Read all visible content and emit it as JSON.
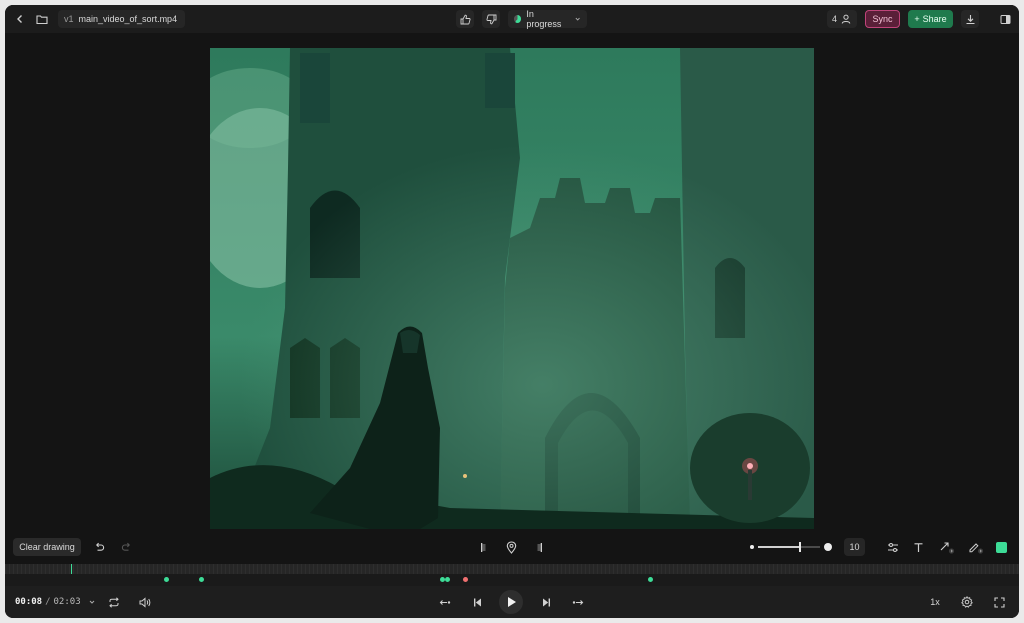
{
  "header": {
    "back_icon": "chevron-left-icon",
    "folder_icon": "folder-icon",
    "version": "v1",
    "filename": "main_video_of_sort.mp4",
    "status": "In progress",
    "viewer_count": "4",
    "sync_label": "Sync",
    "share_label": "Share"
  },
  "toolbar": {
    "clear_label": "Clear drawing",
    "stroke_size": "10",
    "stroke_level": 0.6
  },
  "playback": {
    "current_time": "00:08",
    "separator": "/",
    "duration": "02:03",
    "speed": "1x",
    "progress": 0.065
  },
  "comment_markers": [
    {
      "pos": 0.159,
      "color": "#3ddc97"
    },
    {
      "pos": 0.193,
      "color": "#3ddc97"
    },
    {
      "pos": 0.431,
      "color": "#3ddc97"
    },
    {
      "pos": 0.436,
      "color": "#3ddc97"
    },
    {
      "pos": 0.454,
      "color": "#f07070"
    },
    {
      "pos": 0.636,
      "color": "#3ddc97"
    }
  ],
  "colors": {
    "accent": "#3ddc97",
    "sync": "#c0447a",
    "share": "#1f7a4d"
  }
}
